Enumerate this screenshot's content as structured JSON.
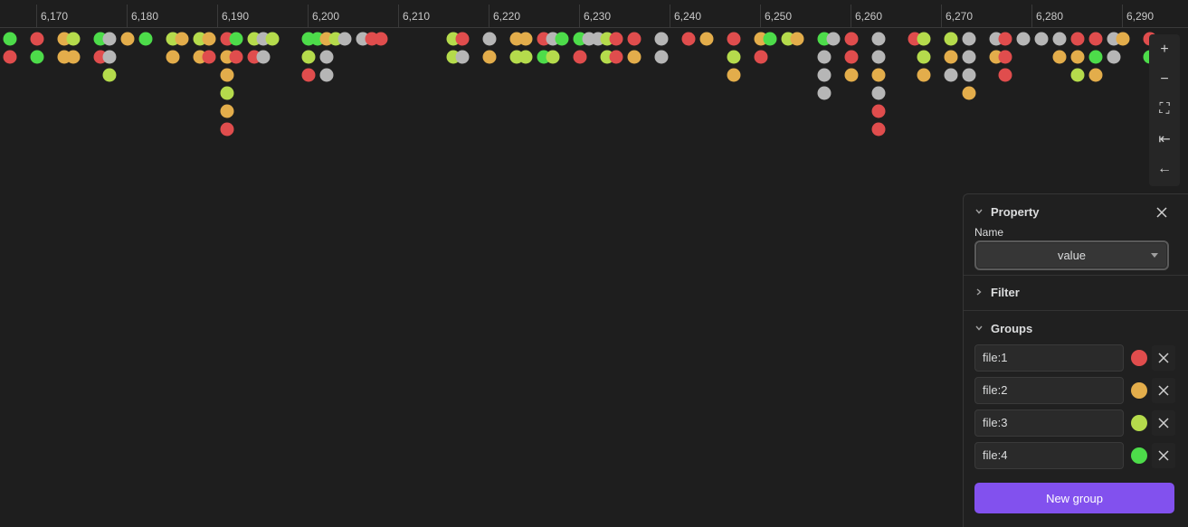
{
  "timeline": {
    "ticks": [
      "6,170",
      "6,180",
      "6,190",
      "6,200",
      "6,210",
      "6,220",
      "6,230",
      "6,240",
      "6,250",
      "6,260",
      "6,270",
      "6,280",
      "6,290"
    ],
    "start_value": 6165,
    "unit_per_tick": 10,
    "colors": {
      "file1": "#e04d4d",
      "file2": "#e3ad4b",
      "file3": "#b5db4c",
      "file4": "#4ddc4a",
      "ungrouped": "#b6b6b6"
    },
    "columns": [
      {
        "v": 6167,
        "dots": [
          "file4",
          "file1"
        ]
      },
      {
        "v": 6170,
        "dots": [
          "file1",
          "file4"
        ]
      },
      {
        "v": 6173,
        "dots": [
          "file2",
          "file2"
        ]
      },
      {
        "v": 6174,
        "dots": [
          "file3",
          "file2"
        ]
      },
      {
        "v": 6177,
        "dots": [
          "file4",
          "file1"
        ]
      },
      {
        "v": 6178,
        "dots": [
          "ungrouped",
          "ungrouped",
          "file3"
        ]
      },
      {
        "v": 6180,
        "dots": [
          "file2"
        ]
      },
      {
        "v": 6182,
        "dots": [
          "file4"
        ]
      },
      {
        "v": 6185,
        "dots": [
          "file3",
          "file2"
        ]
      },
      {
        "v": 6186,
        "dots": [
          "file2"
        ]
      },
      {
        "v": 6188,
        "dots": [
          "file3",
          "file2"
        ]
      },
      {
        "v": 6189,
        "dots": [
          "file2",
          "file1"
        ]
      },
      {
        "v": 6191,
        "dots": [
          "file1",
          "file2",
          "file2",
          "file3",
          "file2",
          "file1"
        ]
      },
      {
        "v": 6192,
        "dots": [
          "file4",
          "file1"
        ]
      },
      {
        "v": 6194,
        "dots": [
          "file3",
          "file1"
        ]
      },
      {
        "v": 6195,
        "dots": [
          "ungrouped",
          "ungrouped"
        ]
      },
      {
        "v": 6196,
        "dots": [
          "file3"
        ]
      },
      {
        "v": 6200,
        "dots": [
          "file4",
          "file3",
          "file1"
        ]
      },
      {
        "v": 6201,
        "dots": [
          "file4"
        ]
      },
      {
        "v": 6202,
        "dots": [
          "file2",
          "ungrouped",
          "ungrouped"
        ]
      },
      {
        "v": 6203,
        "dots": [
          "file3"
        ]
      },
      {
        "v": 6204,
        "dots": [
          "ungrouped"
        ]
      },
      {
        "v": 6206,
        "dots": [
          "ungrouped"
        ]
      },
      {
        "v": 6207,
        "dots": [
          "file1"
        ]
      },
      {
        "v": 6208,
        "dots": [
          "file1"
        ]
      },
      {
        "v": 6216,
        "dots": [
          "file3",
          "file3"
        ]
      },
      {
        "v": 6217,
        "dots": [
          "file1",
          "ungrouped"
        ]
      },
      {
        "v": 6220,
        "dots": [
          "ungrouped",
          "file2"
        ]
      },
      {
        "v": 6223,
        "dots": [
          "file2",
          "file3"
        ]
      },
      {
        "v": 6224,
        "dots": [
          "file2",
          "file3"
        ]
      },
      {
        "v": 6226,
        "dots": [
          "file1",
          "file4"
        ]
      },
      {
        "v": 6227,
        "dots": [
          "ungrouped",
          "file3"
        ]
      },
      {
        "v": 6228,
        "dots": [
          "file4"
        ]
      },
      {
        "v": 6230,
        "dots": [
          "file4",
          "file1"
        ]
      },
      {
        "v": 6231,
        "dots": [
          "ungrouped"
        ]
      },
      {
        "v": 6232,
        "dots": [
          "ungrouped"
        ]
      },
      {
        "v": 6233,
        "dots": [
          "file3",
          "file3"
        ]
      },
      {
        "v": 6234,
        "dots": [
          "file1",
          "file1"
        ]
      },
      {
        "v": 6236,
        "dots": [
          "file1",
          "file2"
        ]
      },
      {
        "v": 6239,
        "dots": [
          "ungrouped",
          "ungrouped"
        ]
      },
      {
        "v": 6242,
        "dots": [
          "file1"
        ]
      },
      {
        "v": 6244,
        "dots": [
          "file2"
        ]
      },
      {
        "v": 6247,
        "dots": [
          "file1",
          "file3",
          "file2"
        ]
      },
      {
        "v": 6250,
        "dots": [
          "file2",
          "file1"
        ]
      },
      {
        "v": 6251,
        "dots": [
          "file4"
        ]
      },
      {
        "v": 6253,
        "dots": [
          "file3"
        ]
      },
      {
        "v": 6254,
        "dots": [
          "file2"
        ]
      },
      {
        "v": 6257,
        "dots": [
          "file4",
          "ungrouped",
          "ungrouped",
          "ungrouped"
        ]
      },
      {
        "v": 6258,
        "dots": [
          "ungrouped"
        ]
      },
      {
        "v": 6260,
        "dots": [
          "file1",
          "file1",
          "file2"
        ]
      },
      {
        "v": 6263,
        "dots": [
          "ungrouped",
          "ungrouped",
          "file2",
          "ungrouped",
          "file1",
          "file1"
        ]
      },
      {
        "v": 6267,
        "dots": [
          "file1"
        ]
      },
      {
        "v": 6268,
        "dots": [
          "file3",
          "file3",
          "file2"
        ]
      },
      {
        "v": 6271,
        "dots": [
          "file3",
          "file2",
          "ungrouped"
        ]
      },
      {
        "v": 6273,
        "dots": [
          "ungrouped",
          "ungrouped",
          "ungrouped",
          "file2"
        ]
      },
      {
        "v": 6276,
        "dots": [
          "ungrouped",
          "file2"
        ]
      },
      {
        "v": 6277,
        "dots": [
          "file1",
          "file1",
          "file1"
        ]
      },
      {
        "v": 6279,
        "dots": [
          "ungrouped"
        ]
      },
      {
        "v": 6281,
        "dots": [
          "ungrouped"
        ]
      },
      {
        "v": 6283,
        "dots": [
          "ungrouped",
          "file2"
        ]
      },
      {
        "v": 6285,
        "dots": [
          "file1",
          "file2",
          "file3"
        ]
      },
      {
        "v": 6287,
        "dots": [
          "file1",
          "file4",
          "file2"
        ]
      },
      {
        "v": 6289,
        "dots": [
          "ungrouped",
          "ungrouped"
        ]
      },
      {
        "v": 6290,
        "dots": [
          "file2"
        ]
      },
      {
        "v": 6293,
        "dots": [
          "file1",
          "file4"
        ]
      }
    ]
  },
  "toolbar": {
    "zoom_in": "+",
    "zoom_out": "−",
    "fit": "⛶",
    "to_start": "⇤",
    "back": "←"
  },
  "panel": {
    "property_title": "Property",
    "name_label": "Name",
    "name_value": "value",
    "filter_title": "Filter",
    "groups_title": "Groups",
    "groups": [
      {
        "label": "file:1",
        "color": "#e04d4d"
      },
      {
        "label": "file:2",
        "color": "#e3ad4b"
      },
      {
        "label": "file:3",
        "color": "#b5db4c"
      },
      {
        "label": "file:4",
        "color": "#4ddc4a"
      }
    ],
    "new_group_label": "New group"
  }
}
